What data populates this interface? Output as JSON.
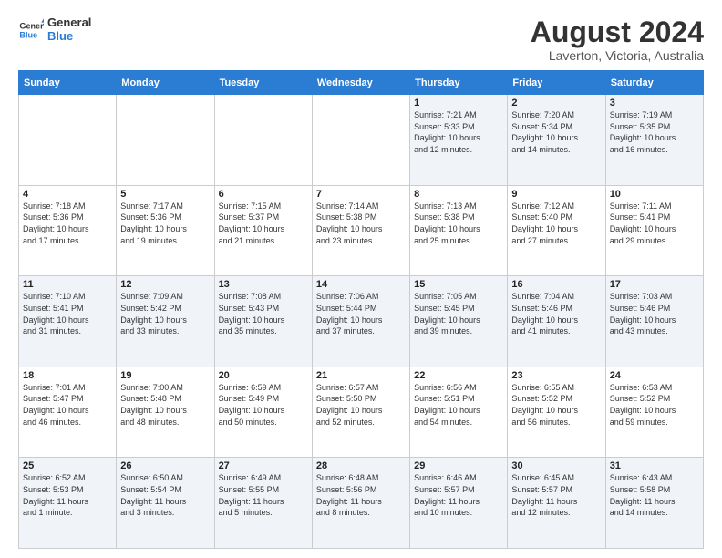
{
  "header": {
    "logo_line1": "General",
    "logo_line2": "Blue",
    "title": "August 2024",
    "subtitle": "Laverton, Victoria, Australia"
  },
  "days_of_week": [
    "Sunday",
    "Monday",
    "Tuesday",
    "Wednesday",
    "Thursday",
    "Friday",
    "Saturday"
  ],
  "weeks": [
    [
      {
        "day": "",
        "info": ""
      },
      {
        "day": "",
        "info": ""
      },
      {
        "day": "",
        "info": ""
      },
      {
        "day": "",
        "info": ""
      },
      {
        "day": "1",
        "info": "Sunrise: 7:21 AM\nSunset: 5:33 PM\nDaylight: 10 hours\nand 12 minutes."
      },
      {
        "day": "2",
        "info": "Sunrise: 7:20 AM\nSunset: 5:34 PM\nDaylight: 10 hours\nand 14 minutes."
      },
      {
        "day": "3",
        "info": "Sunrise: 7:19 AM\nSunset: 5:35 PM\nDaylight: 10 hours\nand 16 minutes."
      }
    ],
    [
      {
        "day": "4",
        "info": "Sunrise: 7:18 AM\nSunset: 5:36 PM\nDaylight: 10 hours\nand 17 minutes."
      },
      {
        "day": "5",
        "info": "Sunrise: 7:17 AM\nSunset: 5:36 PM\nDaylight: 10 hours\nand 19 minutes."
      },
      {
        "day": "6",
        "info": "Sunrise: 7:15 AM\nSunset: 5:37 PM\nDaylight: 10 hours\nand 21 minutes."
      },
      {
        "day": "7",
        "info": "Sunrise: 7:14 AM\nSunset: 5:38 PM\nDaylight: 10 hours\nand 23 minutes."
      },
      {
        "day": "8",
        "info": "Sunrise: 7:13 AM\nSunset: 5:38 PM\nDaylight: 10 hours\nand 25 minutes."
      },
      {
        "day": "9",
        "info": "Sunrise: 7:12 AM\nSunset: 5:40 PM\nDaylight: 10 hours\nand 27 minutes."
      },
      {
        "day": "10",
        "info": "Sunrise: 7:11 AM\nSunset: 5:41 PM\nDaylight: 10 hours\nand 29 minutes."
      }
    ],
    [
      {
        "day": "11",
        "info": "Sunrise: 7:10 AM\nSunset: 5:41 PM\nDaylight: 10 hours\nand 31 minutes."
      },
      {
        "day": "12",
        "info": "Sunrise: 7:09 AM\nSunset: 5:42 PM\nDaylight: 10 hours\nand 33 minutes."
      },
      {
        "day": "13",
        "info": "Sunrise: 7:08 AM\nSunset: 5:43 PM\nDaylight: 10 hours\nand 35 minutes."
      },
      {
        "day": "14",
        "info": "Sunrise: 7:06 AM\nSunset: 5:44 PM\nDaylight: 10 hours\nand 37 minutes."
      },
      {
        "day": "15",
        "info": "Sunrise: 7:05 AM\nSunset: 5:45 PM\nDaylight: 10 hours\nand 39 minutes."
      },
      {
        "day": "16",
        "info": "Sunrise: 7:04 AM\nSunset: 5:46 PM\nDaylight: 10 hours\nand 41 minutes."
      },
      {
        "day": "17",
        "info": "Sunrise: 7:03 AM\nSunset: 5:46 PM\nDaylight: 10 hours\nand 43 minutes."
      }
    ],
    [
      {
        "day": "18",
        "info": "Sunrise: 7:01 AM\nSunset: 5:47 PM\nDaylight: 10 hours\nand 46 minutes."
      },
      {
        "day": "19",
        "info": "Sunrise: 7:00 AM\nSunset: 5:48 PM\nDaylight: 10 hours\nand 48 minutes."
      },
      {
        "day": "20",
        "info": "Sunrise: 6:59 AM\nSunset: 5:49 PM\nDaylight: 10 hours\nand 50 minutes."
      },
      {
        "day": "21",
        "info": "Sunrise: 6:57 AM\nSunset: 5:50 PM\nDaylight: 10 hours\nand 52 minutes."
      },
      {
        "day": "22",
        "info": "Sunrise: 6:56 AM\nSunset: 5:51 PM\nDaylight: 10 hours\nand 54 minutes."
      },
      {
        "day": "23",
        "info": "Sunrise: 6:55 AM\nSunset: 5:52 PM\nDaylight: 10 hours\nand 56 minutes."
      },
      {
        "day": "24",
        "info": "Sunrise: 6:53 AM\nSunset: 5:52 PM\nDaylight: 10 hours\nand 59 minutes."
      }
    ],
    [
      {
        "day": "25",
        "info": "Sunrise: 6:52 AM\nSunset: 5:53 PM\nDaylight: 11 hours\nand 1 minute."
      },
      {
        "day": "26",
        "info": "Sunrise: 6:50 AM\nSunset: 5:54 PM\nDaylight: 11 hours\nand 3 minutes."
      },
      {
        "day": "27",
        "info": "Sunrise: 6:49 AM\nSunset: 5:55 PM\nDaylight: 11 hours\nand 5 minutes."
      },
      {
        "day": "28",
        "info": "Sunrise: 6:48 AM\nSunset: 5:56 PM\nDaylight: 11 hours\nand 8 minutes."
      },
      {
        "day": "29",
        "info": "Sunrise: 6:46 AM\nSunset: 5:57 PM\nDaylight: 11 hours\nand 10 minutes."
      },
      {
        "day": "30",
        "info": "Sunrise: 6:45 AM\nSunset: 5:57 PM\nDaylight: 11 hours\nand 12 minutes."
      },
      {
        "day": "31",
        "info": "Sunrise: 6:43 AM\nSunset: 5:58 PM\nDaylight: 11 hours\nand 14 minutes."
      }
    ]
  ]
}
